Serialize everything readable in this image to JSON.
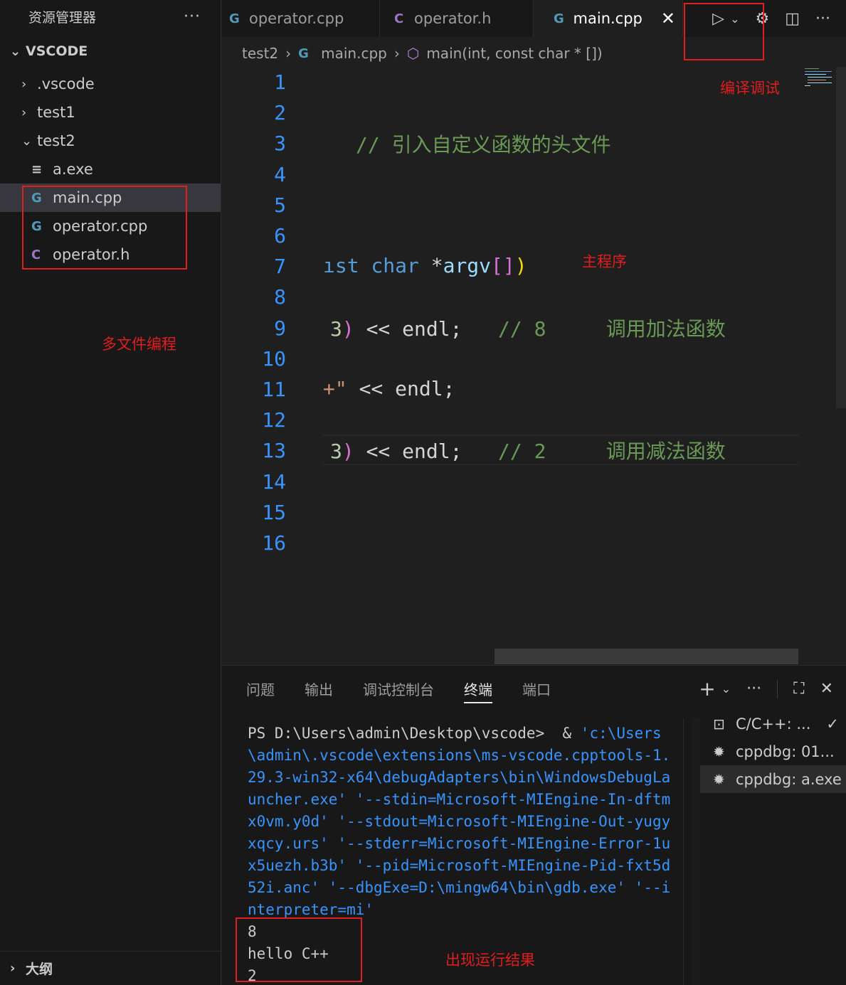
{
  "sidebar": {
    "title": "资源管理器",
    "more": "···",
    "root": "VSCODE",
    "items": [
      {
        "chevron": "›",
        "label": ".vscode"
      },
      {
        "chevron": "›",
        "label": "test1"
      },
      {
        "chevron": "⌄",
        "label": "test2"
      }
    ],
    "files": [
      {
        "icon": "≡",
        "label": "a.exe"
      },
      {
        "icon": "G",
        "label": "main.cpp"
      },
      {
        "icon": "G",
        "label": "operator.cpp"
      },
      {
        "icon": "C",
        "label": "operator.h"
      }
    ],
    "outline": "大纲"
  },
  "tabs": [
    {
      "icon": "G",
      "label": "operator.cpp"
    },
    {
      "icon": "C",
      "label": "operator.h"
    },
    {
      "icon": "G",
      "label": "main.cpp",
      "close": "✕"
    }
  ],
  "breadcrumb": {
    "folder": "test2",
    "file": "main.cpp",
    "symbol": "main(int, const char * [])"
  },
  "editor": {
    "line_numbers": [
      "1",
      "2",
      "3",
      "4",
      "5",
      "6",
      "7",
      "8",
      "9",
      "10",
      "11",
      "12",
      "13",
      "14",
      "15",
      "16"
    ],
    "line3_comment": "// 引入自定义函数的头文件",
    "line7": {
      "a": "ıst",
      "b": "char",
      "c": "*",
      "d": "argv",
      "e": "[]",
      "f": ")"
    },
    "line9": {
      "num": "3",
      "paren": ")",
      "rest": " << endl;",
      "comment": "// 8     调用加法函数"
    },
    "line11": {
      "str": "+\"",
      "rest": " << endl;"
    },
    "line13": {
      "num": "3",
      "paren": ")",
      "rest": " << endl;",
      "comment": "// 2     调用减法函数"
    }
  },
  "panel": {
    "tabs": [
      "问题",
      "输出",
      "调试控制台",
      "终端",
      "端口"
    ],
    "active_tab": "终端",
    "terminal": {
      "prompt": "PS D:\\Users\\admin\\Desktop\\vscode>  & ",
      "command": "'c:\\Users\\admin\\.vscode\\extensions\\ms-vscode.cpptools-1.29.3-win32-x64\\debugAdapters\\bin\\WindowsDebugLauncher.exe' '--stdin=Microsoft-MIEngine-In-dftmx0vm.y0d' '--stdout=Microsoft-MIEngine-Out-yugyxqcy.urs' '--stderr=Microsoft-MIEngine-Error-1ux5uezh.b3b' '--pid=Microsoft-MIEngine-Pid-fxt5d52i.anc' '--dbgExe=D:\\mingw64\\bin\\gdb.exe' '--interpreter=mi'",
      "output": [
        "8",
        "hello C++",
        "2"
      ]
    },
    "sessions": [
      {
        "label": "C/C++: ...",
        "check": "✓"
      },
      {
        "label": "cppdbg: 01..."
      },
      {
        "label": "cppdbg: a.exe"
      }
    ]
  },
  "annotations": {
    "compile_debug": "编译调试",
    "main_program": "主程序",
    "multi_file": "多文件编程",
    "result": "出现运行结果"
  }
}
